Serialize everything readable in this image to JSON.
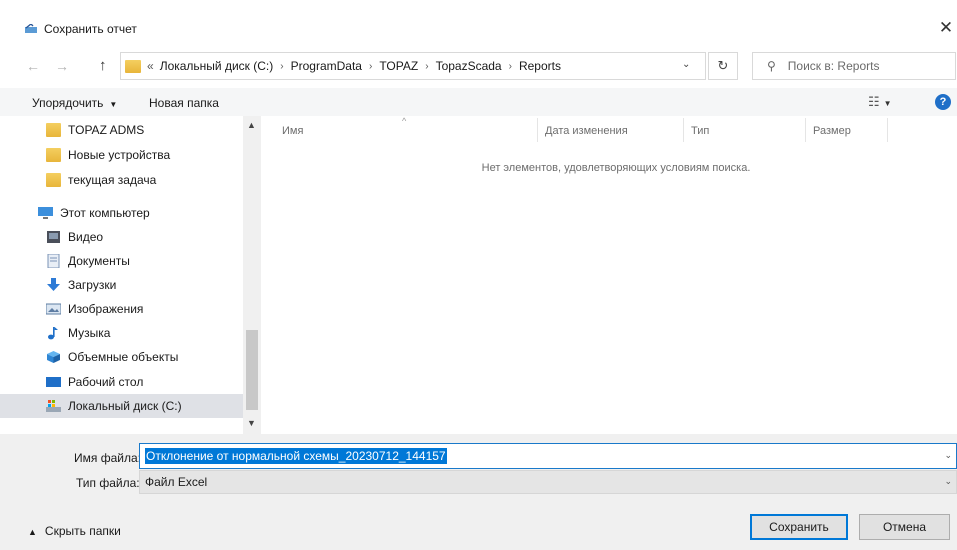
{
  "window": {
    "title": "Сохранить отчет",
    "close_glyph": "✕"
  },
  "navigation": {
    "back_glyph": "←",
    "forward_glyph": "→",
    "up_glyph": "↑",
    "address_prefix": "«",
    "breadcrumbs": [
      "Локальный диск (C:)",
      "ProgramData",
      "TOPAZ",
      "TopazScada",
      "Reports"
    ],
    "separator_glyph": "›",
    "dropdown_glyph": "⌄",
    "refresh_glyph": "↻",
    "search_glyph": "⚲",
    "search_placeholder": "Поиск в: Reports"
  },
  "toolbar": {
    "organize_label": "Упорядочить",
    "organize_arrow": "▼",
    "new_folder_label": "Новая папка",
    "view_glyph": "☷",
    "view_arrow": "▼",
    "help_label": "?"
  },
  "sidebar": {
    "items": [
      {
        "label": "TOPAZ ADMS",
        "icon": "folder-icon"
      },
      {
        "label": "Новые устройства",
        "icon": "folder-icon"
      },
      {
        "label": "текущая задача",
        "icon": "folder-icon"
      },
      {
        "label": "Этот компьютер",
        "icon": "computer-icon"
      },
      {
        "label": "Видео",
        "icon": "video-icon"
      },
      {
        "label": "Документы",
        "icon": "documents-icon"
      },
      {
        "label": "Загрузки",
        "icon": "downloads-icon"
      },
      {
        "label": "Изображения",
        "icon": "pictures-icon"
      },
      {
        "label": "Музыка",
        "icon": "music-icon"
      },
      {
        "label": "Объемные объекты",
        "icon": "3d-objects-icon"
      },
      {
        "label": "Рабочий стол",
        "icon": "desktop-icon"
      },
      {
        "label": "Локальный диск (C:)",
        "icon": "drive-icon"
      }
    ],
    "selected_index": 11,
    "scroll_up_glyph": "▲",
    "scroll_down_glyph": "▼"
  },
  "file_list": {
    "columns": [
      "Имя",
      "Дата изменения",
      "Тип",
      "Размер"
    ],
    "sort_glyph": "^",
    "empty_message": "Нет элементов, удовлетворяющих условиям поиска."
  },
  "save_form": {
    "filename_label": "Имя файла:",
    "filename_value": "Отклонение от нормальной схемы_20230712_144157",
    "filetype_label": "Тип файла:",
    "filetype_value": "Файл Excel",
    "dropdown_glyph": "⌄"
  },
  "footer": {
    "hide_folders_arrow": "▲",
    "hide_folders_label": "Скрыть папки",
    "save_label": "Сохранить",
    "cancel_label": "Отмена"
  },
  "colors": {
    "accent": "#0078d7",
    "folder": "#f0c24b",
    "help": "#1f6fc8"
  }
}
